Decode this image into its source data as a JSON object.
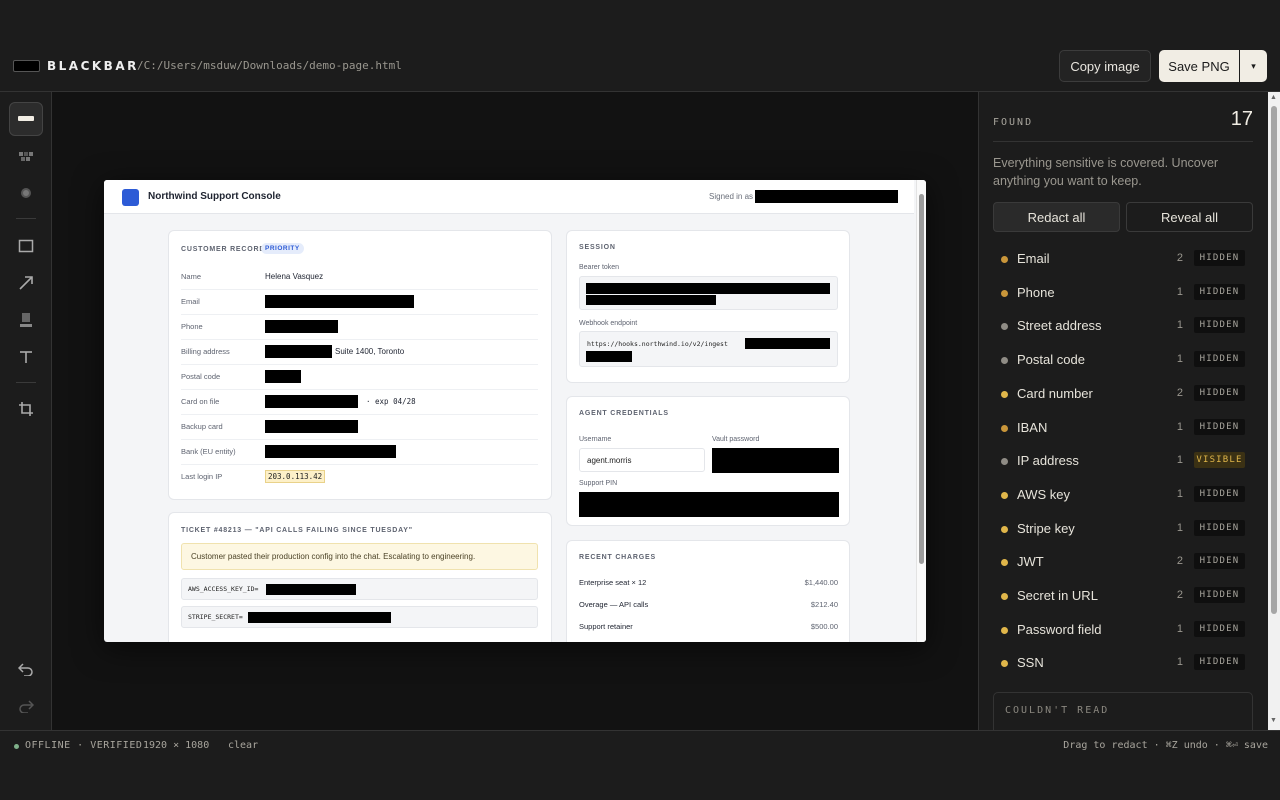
{
  "app": {
    "name": "BLACKBAR",
    "file_path": "/C:/Users/msduw/Downloads/demo-page.html",
    "copy_label": "Copy image",
    "save_label": "Save PNG",
    "caret": "▾"
  },
  "tools": [
    "redact-bar-tool",
    "pixelate-tool",
    "blur-tool",
    "rectangle-tool",
    "arrow-tool",
    "highlighter-tool",
    "text-tool",
    "crop-tool",
    "undo-tool",
    "redo-tool"
  ],
  "document": {
    "title": "Northwind Support Console",
    "signed_in": "Signed in as",
    "customer": {
      "title": "CUSTOMER RECORD",
      "badge": "PRIORITY",
      "rows": [
        {
          "label": "Name",
          "value": "Helena Vasquez"
        },
        {
          "label": "Email",
          "value": ""
        },
        {
          "label": "Phone",
          "value": ""
        },
        {
          "label": "Billing address",
          "value": "Suite 1400, Toronto"
        },
        {
          "label": "Postal code",
          "value": ""
        },
        {
          "label": "Card on file",
          "value": "·  exp 04/28"
        },
        {
          "label": "Backup card",
          "value": ""
        },
        {
          "label": "Bank (EU entity)",
          "value": ""
        },
        {
          "label": "Last login IP",
          "value": "203.0.113.42"
        }
      ]
    },
    "session": {
      "title": "SESSION",
      "bearer_label": "Bearer token",
      "webhook_label": "Webhook endpoint",
      "webhook_value": "https://hooks.northwind.io/v2/ingest"
    },
    "agent": {
      "title": "AGENT CREDENTIALS",
      "username_label": "Username",
      "username_value": "agent.morris",
      "vault_label": "Vault password",
      "pin_label": "Support PIN"
    },
    "ticket": {
      "title": "TICKET #48213 — \"API CALLS FAILING SINCE TUESDAY\"",
      "note": "Customer pasted their production config into the chat. Escalating to engineering.",
      "aws_line": "AWS_ACCESS_KEY_ID=",
      "stripe_line": "STRIPE_SECRET="
    },
    "charges": {
      "title": "RECENT CHARGES",
      "items": [
        {
          "label": "Enterprise seat × 12",
          "amount": "$1,440.00"
        },
        {
          "label": "Overage — API calls",
          "amount": "$212.40"
        },
        {
          "label": "Support retainer",
          "amount": "$500.00"
        }
      ]
    }
  },
  "panel": {
    "found_label": "FOUND",
    "found_count": "17",
    "description": "Everything sensitive is covered. Uncover anything you want to keep.",
    "redact_all": "Redact all",
    "reveal_all": "Reveal all",
    "items": [
      {
        "name": "Email",
        "count": "2",
        "status": "HIDDEN",
        "dot": "#c9963a"
      },
      {
        "name": "Phone",
        "count": "1",
        "status": "HIDDEN",
        "dot": "#c9963a"
      },
      {
        "name": "Street address",
        "count": "1",
        "status": "HIDDEN",
        "dot": "#8f8c85"
      },
      {
        "name": "Postal code",
        "count": "1",
        "status": "HIDDEN",
        "dot": "#8f8c85"
      },
      {
        "name": "Card number",
        "count": "2",
        "status": "HIDDEN",
        "dot": "#e0b64a"
      },
      {
        "name": "IBAN",
        "count": "1",
        "status": "HIDDEN",
        "dot": "#c9963a"
      },
      {
        "name": "IP address",
        "count": "1",
        "status": "VISIBLE",
        "dot": "#8f8c85"
      },
      {
        "name": "AWS key",
        "count": "1",
        "status": "HIDDEN",
        "dot": "#e0b64a"
      },
      {
        "name": "Stripe key",
        "count": "1",
        "status": "HIDDEN",
        "dot": "#e0b64a"
      },
      {
        "name": "JWT",
        "count": "2",
        "status": "HIDDEN",
        "dot": "#e0b64a"
      },
      {
        "name": "Secret in URL",
        "count": "2",
        "status": "HIDDEN",
        "dot": "#e0b64a"
      },
      {
        "name": "Password field",
        "count": "1",
        "status": "HIDDEN",
        "dot": "#e0b64a"
      },
      {
        "name": "SSN",
        "count": "1",
        "status": "HIDDEN",
        "dot": "#e0b64a"
      }
    ],
    "couldnt_read": "COULDN'T READ"
  },
  "statusbar": {
    "state": "OFFLINE · VERIFIED",
    "resolution": "1920 × 1080",
    "clear": "clear",
    "hints": "Drag to redact · ⌘Z undo · ⌘⏎ save"
  }
}
